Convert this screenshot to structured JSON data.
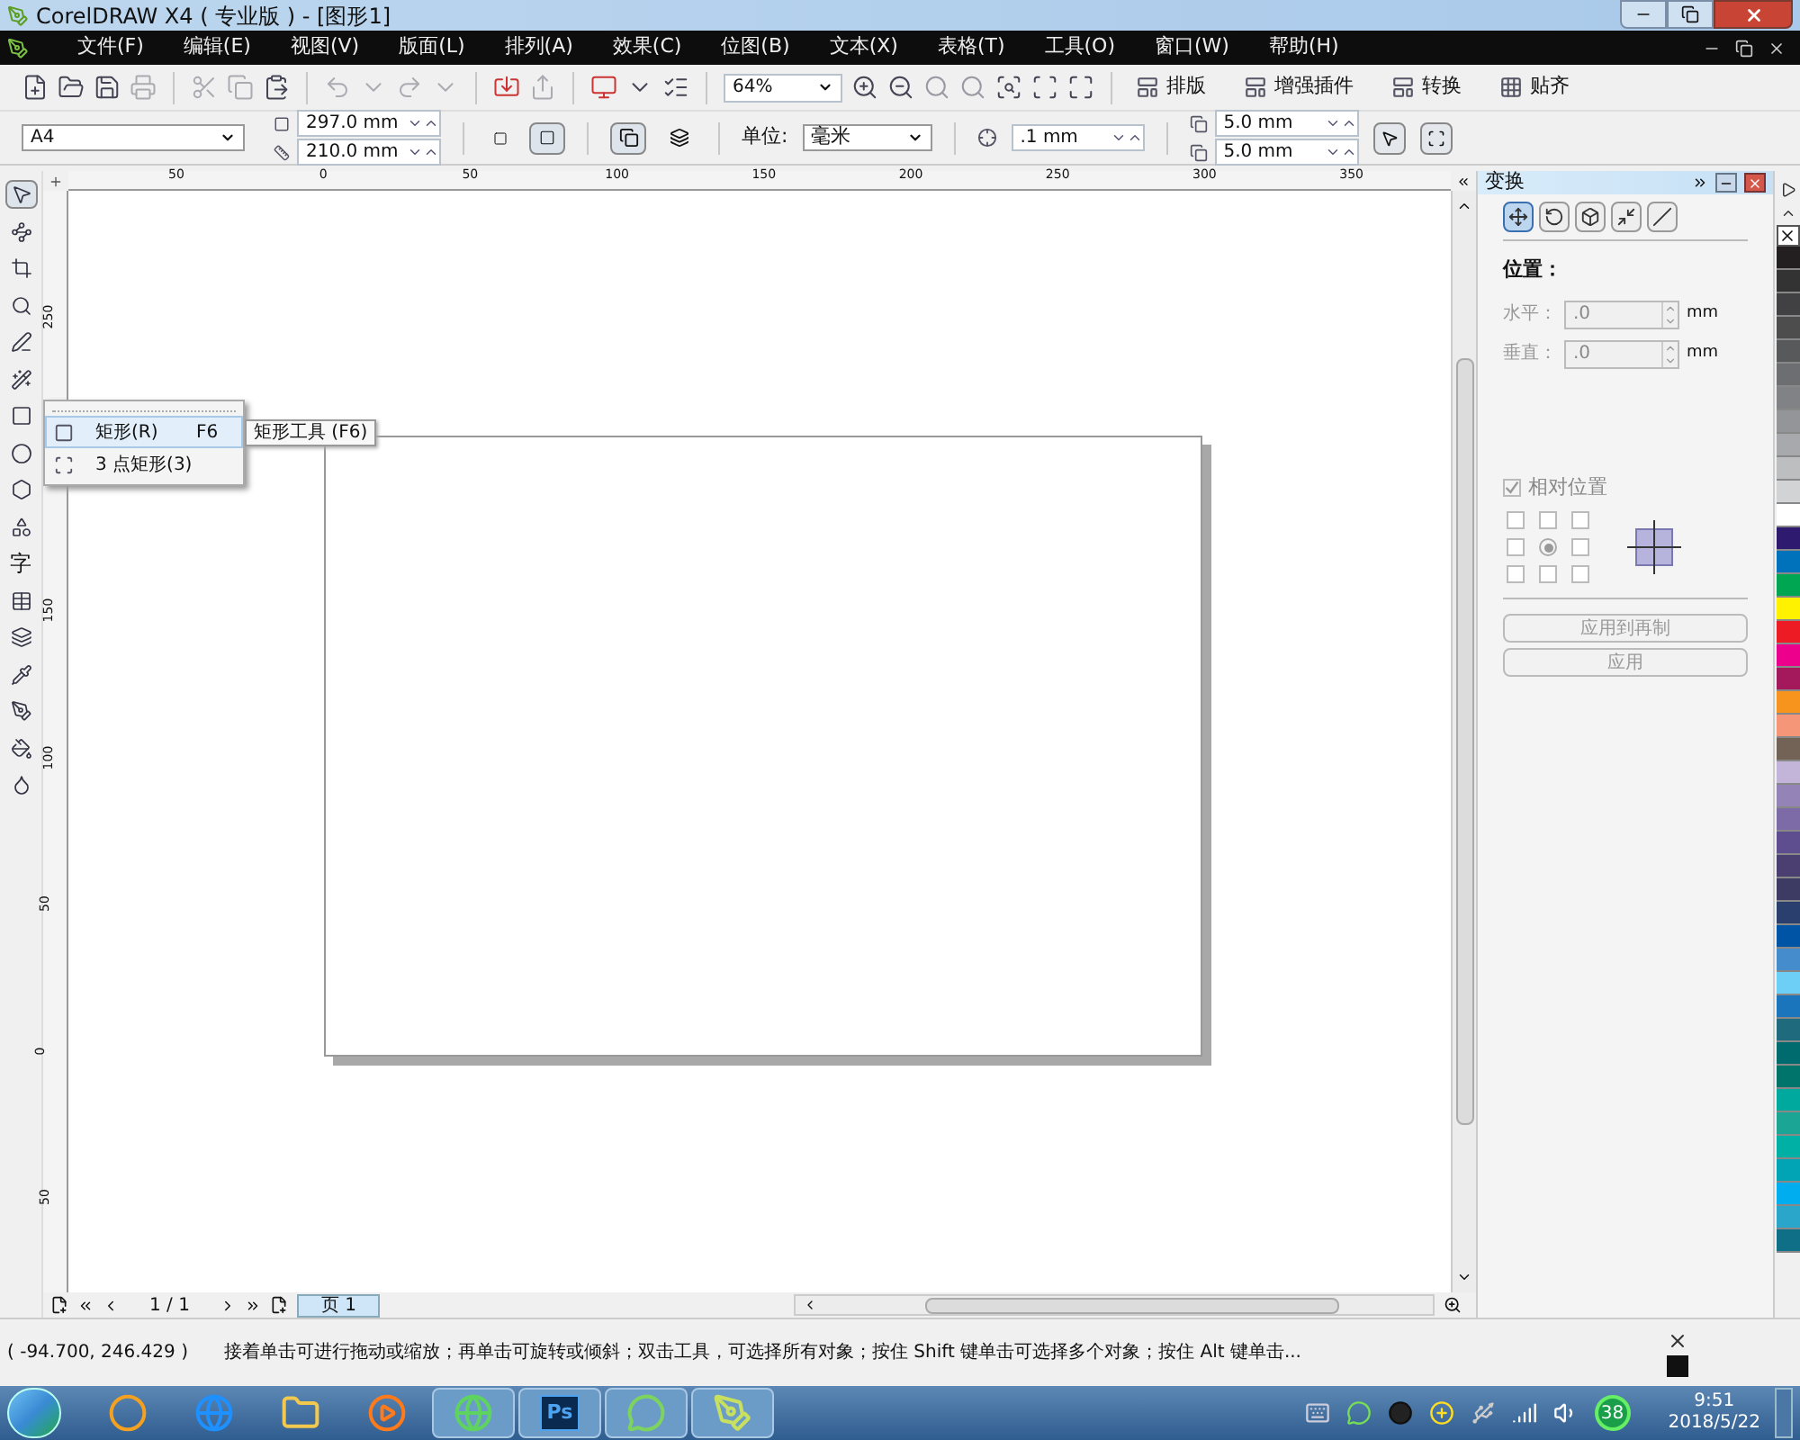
{
  "window": {
    "title": "CorelDRAW X4 ( 专业版 ) - [图形1]"
  },
  "menu": [
    {
      "label": "文件(F)"
    },
    {
      "label": "编辑(E)"
    },
    {
      "label": "视图(V)"
    },
    {
      "label": "版面(L)"
    },
    {
      "label": "排列(A)"
    },
    {
      "label": "效果(C)"
    },
    {
      "label": "位图(B)"
    },
    {
      "label": "文本(X)"
    },
    {
      "label": "表格(T)"
    },
    {
      "label": "工具(O)"
    },
    {
      "label": "窗口(W)"
    },
    {
      "label": "帮助(H)"
    }
  ],
  "standard_toolbar": {
    "zoom": "64%",
    "buttons": [
      {
        "label": "排版"
      },
      {
        "label": "增强插件"
      },
      {
        "label": "转换"
      },
      {
        "label": "贴齐"
      }
    ]
  },
  "property_bar": {
    "paper": "A4",
    "width": "297.0 mm",
    "height": "210.0 mm",
    "orientation": [
      {
        "kind": "portrait",
        "selected": false
      },
      {
        "kind": "landscape",
        "selected": true
      }
    ],
    "page_scope": [
      {
        "selected": true
      },
      {
        "selected": false
      }
    ],
    "unit_label": "单位:",
    "unit": "毫米",
    "nudge": ".1 mm",
    "dup_x": "5.0 mm",
    "dup_y": "5.0 mm"
  },
  "toolbox": [
    {
      "kind": "icon",
      "selected": true
    },
    {
      "kind": "icon",
      "selected": false
    },
    {
      "kind": "icon",
      "selected": false
    },
    {
      "kind": "icon",
      "selected": false
    },
    {
      "kind": "icon",
      "selected": false
    },
    {
      "kind": "icon",
      "selected": false
    },
    {
      "kind": "icon",
      "selected": false
    },
    {
      "kind": "icon",
      "selected": false
    },
    {
      "kind": "icon",
      "selected": false
    },
    {
      "kind": "icon",
      "selected": false
    },
    {
      "kind": "text",
      "label": "字",
      "selected": false
    },
    {
      "kind": "icon",
      "selected": false
    },
    {
      "kind": "icon",
      "selected": false
    },
    {
      "kind": "icon",
      "selected": false
    },
    {
      "kind": "icon",
      "selected": false
    },
    {
      "kind": "icon",
      "selected": false
    },
    {
      "kind": "icon",
      "selected": false
    }
  ],
  "rulers": {
    "horizontal": [
      "50",
      "0",
      "50",
      "100",
      "150",
      "200",
      "250",
      "300",
      "350"
    ],
    "vertical": [
      "250",
      "150",
      "100",
      "50",
      "0",
      "50"
    ]
  },
  "flyout": {
    "items": [
      {
        "label": "矩形(R)",
        "shortcut": "F6",
        "selected": true
      },
      {
        "label": "3 点矩形(3)",
        "selected": false
      }
    ],
    "tooltip": "矩形工具 (F6)"
  },
  "page_nav": {
    "counter": "1 / 1",
    "tab": "页 1"
  },
  "docker": {
    "title": "变换",
    "tabs": [
      {
        "selected": true
      },
      {
        "selected": false
      },
      {
        "selected": false
      },
      {
        "selected": false
      },
      {
        "selected": false
      }
    ],
    "section": "位置：",
    "fields": [
      {
        "label": "水平：",
        "value": ".0",
        "unit": "mm",
        "disabled": true
      },
      {
        "label": "垂直：",
        "value": ".0",
        "unit": "mm",
        "disabled": true
      }
    ],
    "relative": {
      "label": "相对位置",
      "checked": true,
      "disabled": true
    },
    "anchors": [
      {
        "selected": false
      },
      {
        "selected": false
      },
      {
        "selected": false
      },
      {
        "selected": false
      },
      {
        "selected": true
      },
      {
        "selected": false
      },
      {
        "selected": false
      },
      {
        "selected": false
      },
      {
        "selected": false
      }
    ],
    "buttons": [
      {
        "label": "应用到再制",
        "disabled": true
      },
      {
        "label": "应用",
        "disabled": true
      }
    ]
  },
  "palette": [
    {
      "kind": "none"
    },
    {
      "kind": "swatch",
      "color": "#231f20"
    },
    {
      "kind": "swatch",
      "color": "#333333"
    },
    {
      "kind": "swatch",
      "color": "#414042"
    },
    {
      "kind": "swatch",
      "color": "#4d4d4d"
    },
    {
      "kind": "swatch",
      "color": "#58595b"
    },
    {
      "kind": "swatch",
      "color": "#6d6e71"
    },
    {
      "kind": "swatch",
      "color": "#808285"
    },
    {
      "kind": "swatch",
      "color": "#939598"
    },
    {
      "kind": "swatch",
      "color": "#a7a9ac"
    },
    {
      "kind": "swatch",
      "color": "#bcbec0"
    },
    {
      "kind": "swatch",
      "color": "#d1d3d4"
    },
    {
      "kind": "swatch",
      "color": "#ffffff"
    },
    {
      "kind": "swatch",
      "color": "#2e1a6e"
    },
    {
      "kind": "swatch",
      "color": "#0072bc"
    },
    {
      "kind": "swatch",
      "color": "#00a651"
    },
    {
      "kind": "swatch",
      "color": "#fff200"
    },
    {
      "kind": "swatch",
      "color": "#ed1c24"
    },
    {
      "kind": "swatch",
      "color": "#ec008c"
    },
    {
      "kind": "swatch",
      "color": "#a3195b"
    },
    {
      "kind": "swatch",
      "color": "#f7941d"
    },
    {
      "kind": "swatch",
      "color": "#f69679"
    },
    {
      "kind": "swatch",
      "color": "#736357"
    },
    {
      "kind": "swatch",
      "color": "#c2b5d9"
    },
    {
      "kind": "swatch",
      "color": "#9483b6"
    },
    {
      "kind": "swatch",
      "color": "#7d6ba7"
    },
    {
      "kind": "swatch",
      "color": "#5f4e8f"
    },
    {
      "kind": "swatch",
      "color": "#4b3f72"
    },
    {
      "kind": "swatch",
      "color": "#3d3a63"
    },
    {
      "kind": "swatch",
      "color": "#2a3f6e"
    },
    {
      "kind": "swatch",
      "color": "#0054a6"
    },
    {
      "kind": "swatch",
      "color": "#448ccb"
    },
    {
      "kind": "swatch",
      "color": "#6dcff6"
    },
    {
      "kind": "swatch",
      "color": "#1b75bc"
    },
    {
      "kind": "swatch",
      "color": "#206a7e"
    },
    {
      "kind": "swatch",
      "color": "#006b6f"
    },
    {
      "kind": "swatch",
      "color": "#00746b"
    },
    {
      "kind": "swatch",
      "color": "#00a99d"
    },
    {
      "kind": "swatch",
      "color": "#1aa595"
    },
    {
      "kind": "swatch",
      "color": "#00b0a5"
    },
    {
      "kind": "swatch",
      "color": "#00a4b4"
    },
    {
      "kind": "swatch",
      "color": "#00aeef"
    },
    {
      "kind": "swatch",
      "color": "#2ba6cb"
    },
    {
      "kind": "swatch",
      "color": "#0f6f86"
    }
  ],
  "status_bar": {
    "coords": "( -94.700, 246.429 )",
    "message": "接着单击可进行拖动或缩放；再单击可旋转或倾斜；双击工具，可选择所有对象；按住 Shift 键单击可选择多个对象；按住 Alt 键单击..."
  },
  "taskbar": {
    "apps": [
      {
        "kind": "icon",
        "open": false
      },
      {
        "kind": "icon",
        "open": false
      },
      {
        "kind": "icon",
        "open": false
      },
      {
        "kind": "icon",
        "open": false
      },
      {
        "kind": "icon",
        "open": true
      },
      {
        "kind": "text",
        "label": "Ps",
        "open": true
      },
      {
        "kind": "icon",
        "open": true
      },
      {
        "kind": "icon",
        "open": true
      }
    ],
    "badge": "38",
    "time": "9:51",
    "date": "2018/5/22"
  }
}
